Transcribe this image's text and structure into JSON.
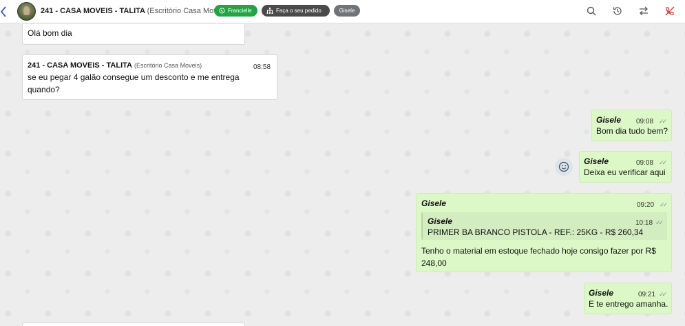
{
  "header": {
    "contact_name": "241 - CASA MOVEIS - TALITA",
    "contact_company": "(Escritório Casa Moveis)",
    "agent_tag": "Francielle",
    "order_tag": "Faça o seu pedido",
    "user_tag": "Gisele",
    "accent_green": "#25a346"
  },
  "messages": [
    {
      "direction": "incoming",
      "text": "Olá bom dia"
    },
    {
      "direction": "incoming",
      "sender": "241 - CASA MOVEIS - TALITA",
      "sender_company": "(Escritório Casa Moveis)",
      "time": "08:58",
      "line1": "se eu pegar 4 galão consegue um desconto e me entrega",
      "line2": "quando?"
    },
    {
      "direction": "outgoing",
      "sender": "Gisele",
      "time": "09:08",
      "text": "Bom dia tudo bem?"
    },
    {
      "direction": "outgoing",
      "sender": "Gisele",
      "time": "09:08",
      "text": "Deixa eu verificar aqui"
    },
    {
      "direction": "outgoing",
      "sender": "Gisele",
      "time": "09:20",
      "quoted": {
        "sender": "Gisele",
        "time": "10:18",
        "text": "PRIMER BA BRANCO PISTOLA - REF.: 25KG - R$ 260,34"
      },
      "line1": "Tenho o material em estoque fechado hoje consigo fazer por R$",
      "line2": "248,00"
    },
    {
      "direction": "outgoing",
      "sender": "Gisele",
      "time": "09:21",
      "text": "E te entrego amanha."
    }
  ],
  "colors": {
    "incoming_bg": "#ffffff",
    "outgoing_bg": "#dcf8c6",
    "chat_bg": "#ededed"
  }
}
